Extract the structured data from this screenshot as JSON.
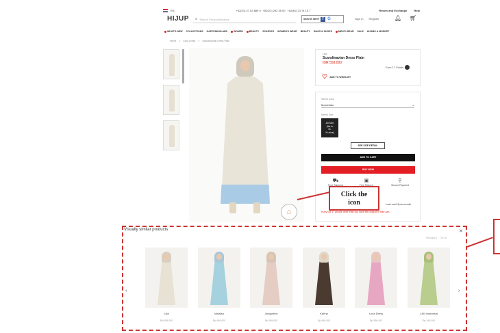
{
  "topbar": {
    "lang": "EN",
    "phone1": "+62(21) 27 63 889 0",
    "phone2": "+62(21) 292 45 00",
    "phone3": "+62(81) 23 74 15 7",
    "return_label": "Return and Exchange",
    "help_label": "Help"
  },
  "header": {
    "logo": "HIJUP",
    "search_placeholder": "Search Products/Brands",
    "signin_with": "SIGN IN WITH",
    "sign_in": "Sign In",
    "register": "Register"
  },
  "categories": [
    {
      "label": "WHAT'S NEW",
      "dot": true
    },
    {
      "label": "COLLECTIONS",
      "dot": false
    },
    {
      "label": "HAPPENINGLABS",
      "dot": false
    },
    {
      "label": "WOMEN",
      "dot": true
    },
    {
      "label": "BEAUTY",
      "dot": true
    },
    {
      "label": "SCARVES",
      "dot": false
    },
    {
      "label": "WOMEN'S WEAR",
      "dot": false
    },
    {
      "label": "BEAUTY",
      "dot": false
    },
    {
      "label": "BAGS & SHOES",
      "dot": false
    },
    {
      "label": "MEN'S WEAR",
      "dot": true
    },
    {
      "label": "SALE",
      "dot": false
    },
    {
      "label": "HIJABS & MODEST",
      "dot": false
    }
  ],
  "breadcrumb": [
    "Home",
    ">",
    "Long Dress",
    ">",
    "Scandinavian Dress Plain"
  ],
  "product": {
    "brand": "Lilia",
    "name": "Scandinavian Dress Plain",
    "price": "IDR 559,000",
    "points": "Earn 17 Points",
    "wishlist": "ADD TO WISHLIST",
    "color_label": "Select Color",
    "color_value": "Mocchiato",
    "size_label": "Select Size",
    "size_value_1": "All Size",
    "size_value_2": "(fits to",
    "size_value_3": "M-",
    "size_value_4": "XL/size)",
    "size_detail": "SEE SIZE DETAIL",
    "add_to_cart": "ADD TO CART",
    "buy_now": "BUY NOW",
    "features": [
      {
        "icon": "⛟",
        "label": "Free Shipping"
      },
      {
        "icon": "▣",
        "label": "Free Returns"
      },
      {
        "icon": "⚲",
        "label": "Secure Payment"
      }
    ],
    "last_sold": "Last sold 3pm month",
    "hurry": "Hurry up! 17 people other than you have the product in their cart"
  },
  "annotation": {
    "callout_line1": "Click the",
    "callout_line2": "icon",
    "target_glyph": "⌂"
  },
  "similar": {
    "title": "Visually similar products",
    "page": "Showing 1 - 7 of 16",
    "items": [
      {
        "name": "Lilia",
        "price": "Rp 559,000",
        "hijab": "#d8cfc2",
        "dress": "#e8e2d5"
      },
      {
        "name": "Malaika",
        "price": "Rp 499,000",
        "hijab": "#a9c7d8",
        "dress": "#a6d1de"
      },
      {
        "name": "Jacqueline",
        "price": "Rp 399,000",
        "hijab": "#d6c4b4",
        "dress": "#e5cdc4"
      },
      {
        "name": "Kahna",
        "price": "Rp 449,000",
        "hijab": "#dfd8c8",
        "dress": "#4a3a30"
      },
      {
        "name": "Luna Dress",
        "price": "Rp 398,400",
        "hijab": "#e8c6c6",
        "dress": "#e7a6c2"
      },
      {
        "name": "LAV Indonesia",
        "price": "Rp 249,000",
        "hijab": "#a9c07a",
        "dress": "#b9cd8e"
      }
    ]
  },
  "colors": {
    "accent_red": "#e31e24",
    "annotation_red": "#c33"
  }
}
